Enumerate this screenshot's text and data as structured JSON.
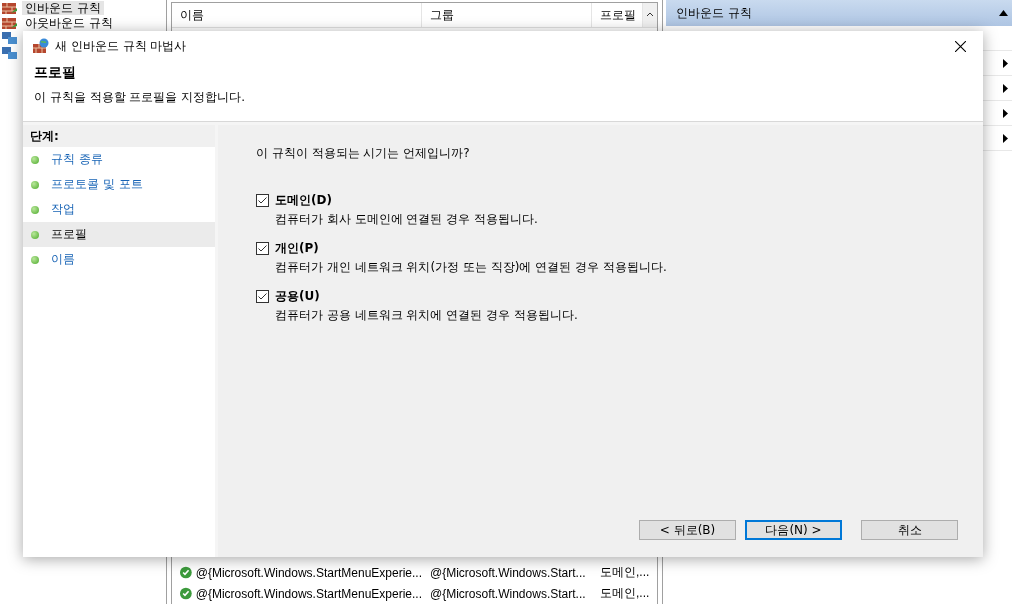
{
  "background_window": {
    "tree": [
      {
        "label": "인바운드 규칙",
        "selected": true
      },
      {
        "label": "아웃바운드 규칙",
        "selected": false
      }
    ],
    "table": {
      "columns": [
        "이름",
        "그룹",
        "프로필"
      ],
      "rows": [
        {
          "enabled": true,
          "cells": [
            "@{Microsoft.Windows.StartMenuExperie...",
            "@{Microsoft.Windows.Start...",
            "도메인,..."
          ]
        },
        {
          "enabled": true,
          "cells": [
            "@{Microsoft.Windows.StartMenuExperie...",
            "@{Microsoft.Windows.Start...",
            "도메인,..."
          ]
        }
      ]
    },
    "actions": {
      "title": "인바운드 규칙"
    }
  },
  "dialog": {
    "title": "새 인바운드 규칙 마법사",
    "heading": "프로필",
    "subtitle": "이 규칙을 적용할 프로필을 지정합니다.",
    "steps_title": "단계:",
    "steps": [
      {
        "label": "규칙 종류",
        "selected": false
      },
      {
        "label": "프로토콜 및 포트",
        "selected": false
      },
      {
        "label": "작업",
        "selected": false
      },
      {
        "label": "프로필",
        "selected": true
      },
      {
        "label": "이름",
        "selected": false
      }
    ],
    "question": "이 규칙이 적용되는 시기는 언제입니까?",
    "options": [
      {
        "label": "도메인(D)",
        "description": "컴퓨터가 회사 도메인에 연결된 경우 적용됩니다.",
        "checked": true
      },
      {
        "label": "개인(P)",
        "description": "컴퓨터가 개인 네트워크 위치(가정 또는 직장)에 연결된 경우 적용됩니다.",
        "checked": true
      },
      {
        "label": "공용(U)",
        "description": "컴퓨터가 공용 네트워크 위치에 연결된 경우 적용됩니다.",
        "checked": true
      }
    ],
    "buttons": [
      {
        "label": "< 뒤로(B)",
        "default": false
      },
      {
        "label": "다음(N) >",
        "default": true
      },
      {
        "label": "취소",
        "default": false
      }
    ]
  }
}
